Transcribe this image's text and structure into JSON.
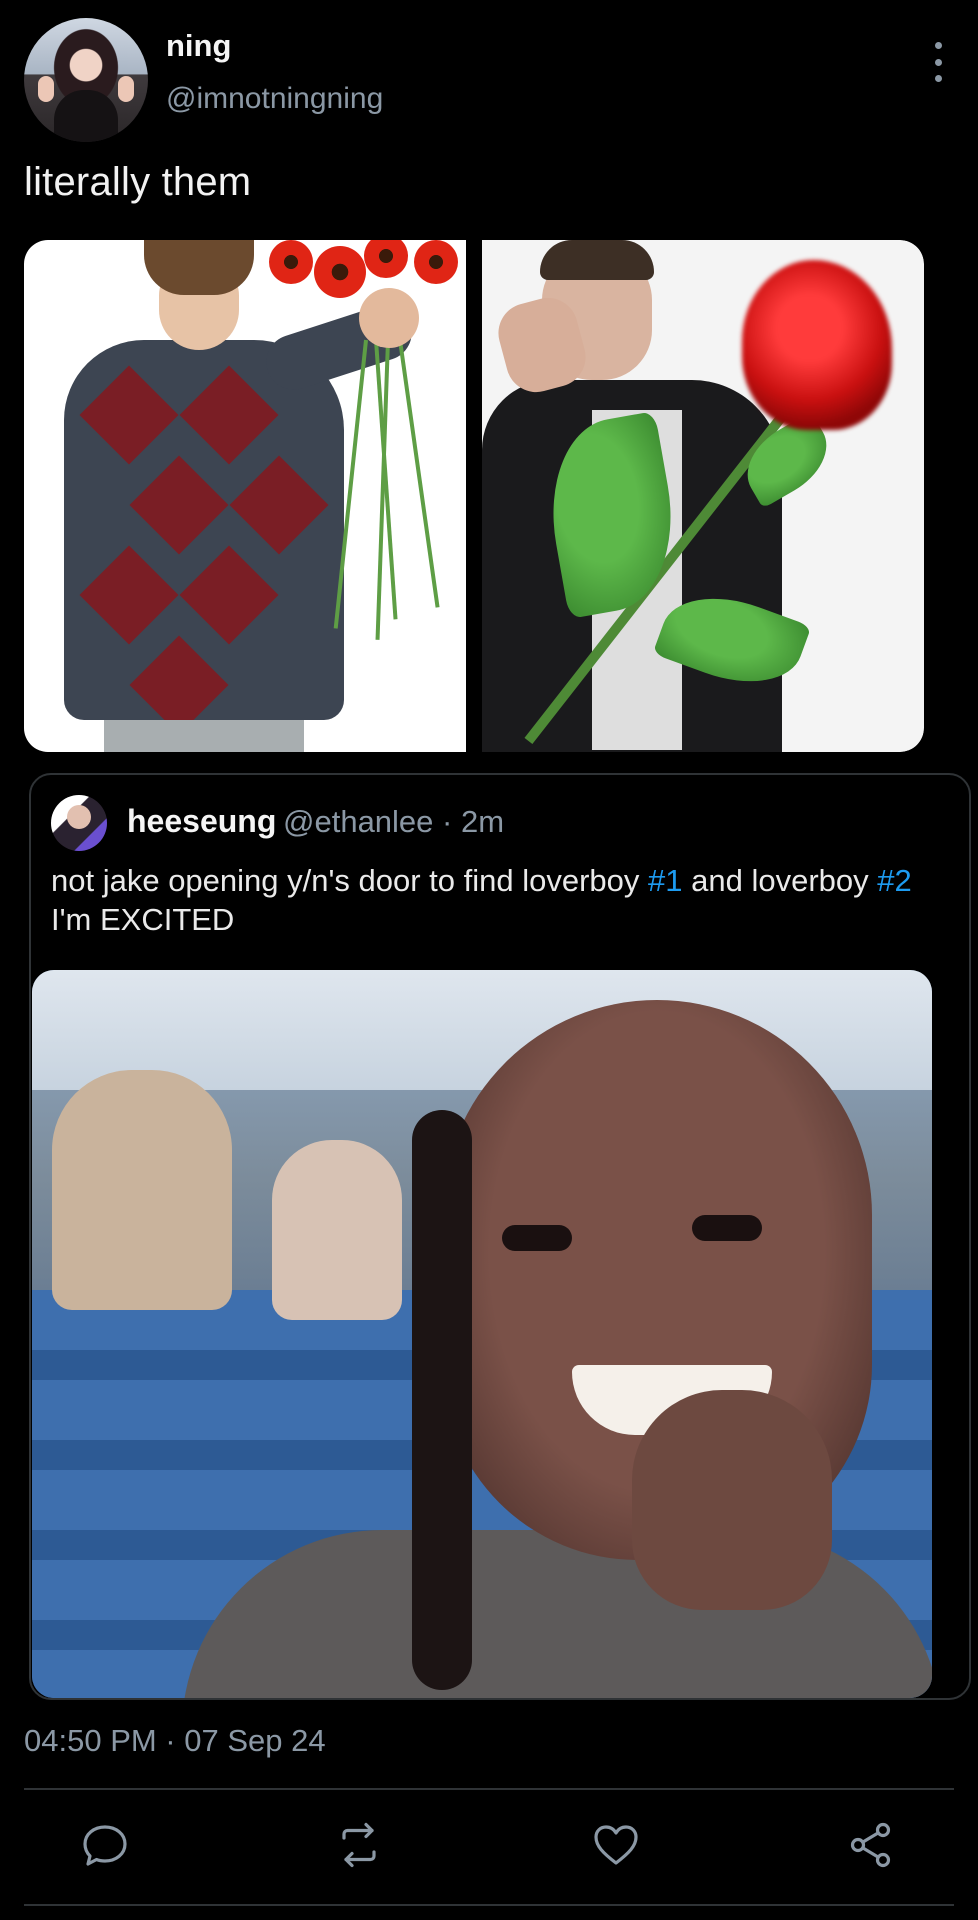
{
  "tweet": {
    "display_name": "ning",
    "handle": "@imnotningning",
    "text": "literally them",
    "timestamp": "04:50 PM · 07 Sep 24"
  },
  "quote": {
    "display_name": "heeseung",
    "handle_time": "@ethanlee · 2m",
    "text_part1": "not jake opening y/n's door to find loverboy ",
    "hashtag1": "#1",
    "text_part2": " and loverboy ",
    "hashtag2": "#2",
    "text_part3": " I'm EXCITED"
  },
  "actions": {
    "reply": "reply-icon",
    "retweet": "retweet-icon",
    "like": "heart-icon",
    "share": "share-icon"
  },
  "colors": {
    "background": "#000000",
    "text": "#e7e9ea",
    "muted": "#8b98a5",
    "accent": "#1d9bf0",
    "border": "#2f3336"
  }
}
